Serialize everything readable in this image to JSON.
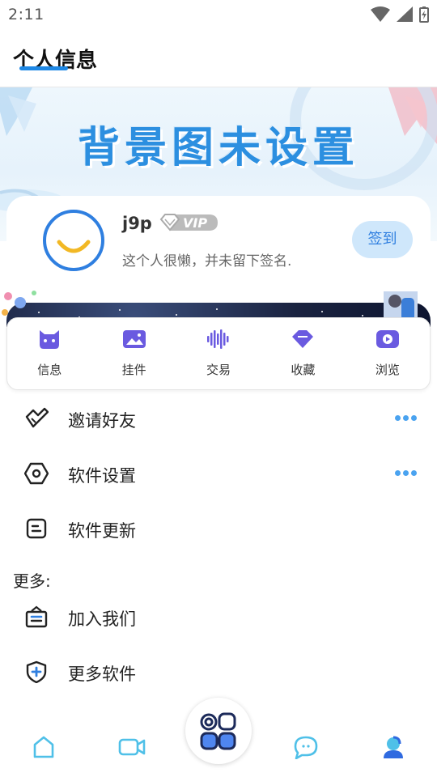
{
  "status_bar": {
    "time": "2:11"
  },
  "header": {
    "title": "个人信息"
  },
  "banner": {
    "text": "背景图未设置"
  },
  "profile": {
    "username": "j9p",
    "badge": "VIP",
    "signature": "这个人很懒，并未留下签名.",
    "checkin_label": "签到"
  },
  "shortcuts": [
    {
      "label": "信息",
      "icon": "cat-face-icon"
    },
    {
      "label": "挂件",
      "icon": "image-icon"
    },
    {
      "label": "交易",
      "icon": "sound-wave-icon"
    },
    {
      "label": "收藏",
      "icon": "diamond-icon"
    },
    {
      "label": "浏览",
      "icon": "play-icon"
    }
  ],
  "menu": [
    {
      "label": "邀请好友",
      "icon": "handshake-icon",
      "has_more": true
    },
    {
      "label": "软件设置",
      "icon": "hexagon-settings-icon",
      "has_more": true
    },
    {
      "label": "软件更新",
      "icon": "update-doc-icon",
      "has_more": false
    }
  ],
  "more_section": {
    "title": "更多:",
    "items": [
      {
        "label": "加入我们",
        "icon": "briefcase-icon"
      },
      {
        "label": "更多软件",
        "icon": "shield-plus-icon"
      }
    ]
  },
  "bottom_nav": [
    {
      "icon": "home-icon"
    },
    {
      "icon": "video-icon"
    },
    {
      "icon": "apps-icon"
    },
    {
      "icon": "chat-icon"
    },
    {
      "icon": "profile-icon"
    }
  ],
  "colors": {
    "accent": "#2f7fe0",
    "icon_purple": "#6a5ae0",
    "more_dots": "#4aa3f0"
  }
}
